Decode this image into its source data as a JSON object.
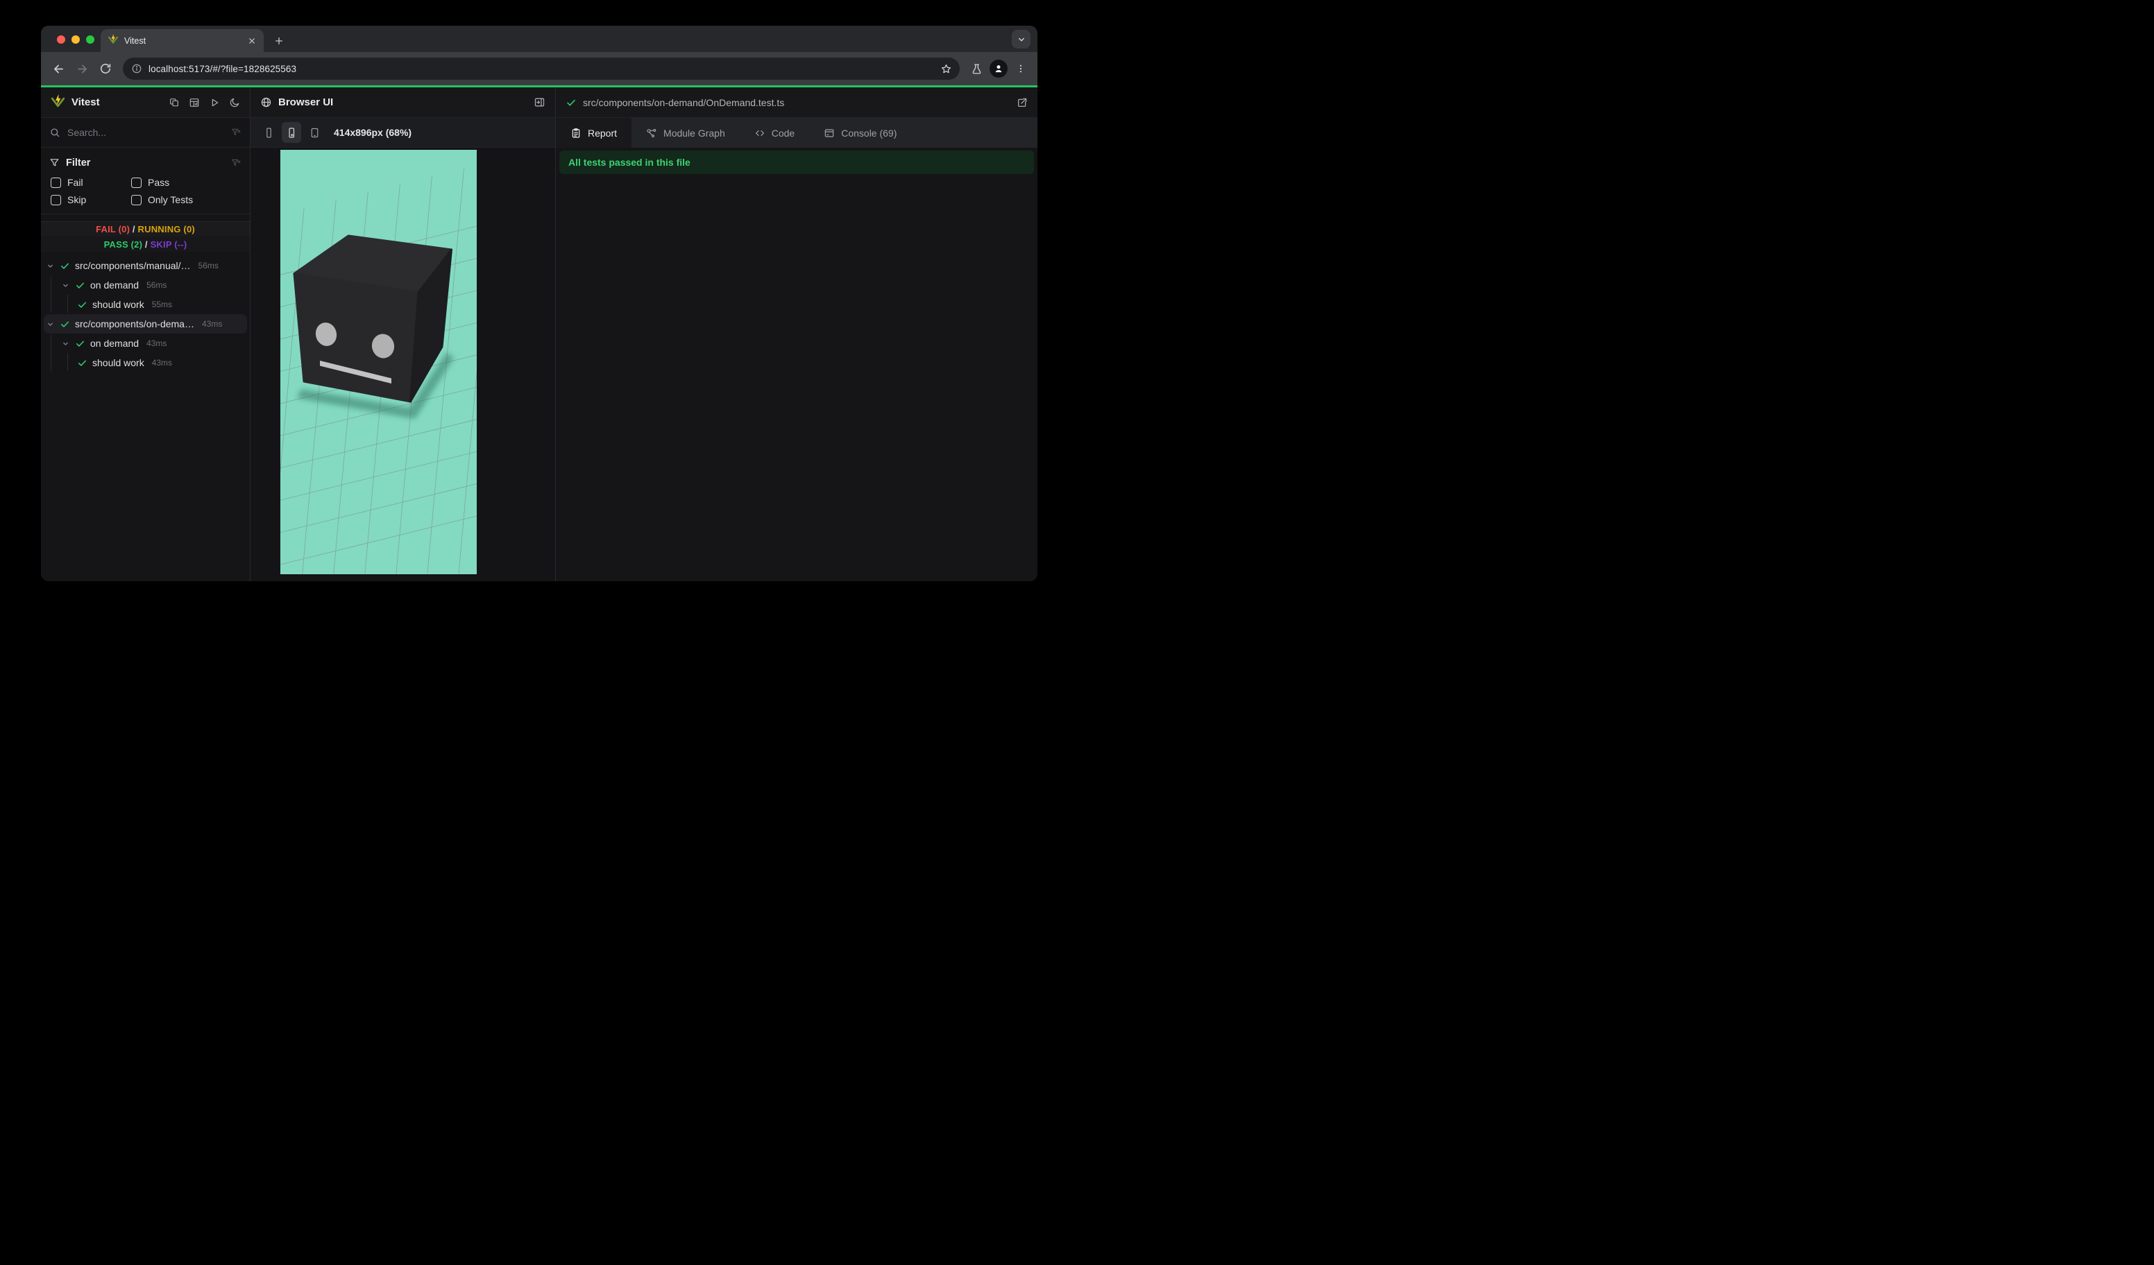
{
  "browser": {
    "tab_title": "Vitest",
    "url": "localhost:5173/#/?file=1828625563"
  },
  "sidebar": {
    "app_title": "Vitest",
    "search_placeholder": "Search...",
    "filter": {
      "title": "Filter",
      "options": [
        "Fail",
        "Pass",
        "Skip",
        "Only Tests"
      ]
    },
    "summary": {
      "fail": "FAIL (0)",
      "running": "RUNNING (0)",
      "pass": "PASS (2)",
      "skip": "SKIP (--)",
      "sep": " / "
    },
    "tree": [
      {
        "label": "src/components/manual/…",
        "time": "56ms"
      },
      {
        "label": "on demand",
        "time": "56ms"
      },
      {
        "label": "should work",
        "time": "55ms"
      },
      {
        "label": "src/components/on-dema…",
        "time": "43ms"
      },
      {
        "label": "on demand",
        "time": "43ms"
      },
      {
        "label": "should work",
        "time": "43ms"
      }
    ]
  },
  "browser_panel": {
    "title": "Browser UI",
    "viewport_label": "414x896px (68%)"
  },
  "report_panel": {
    "file_path": "src/components/on-demand/OnDemand.test.ts",
    "tabs": [
      {
        "label": "Report"
      },
      {
        "label": "Module Graph"
      },
      {
        "label": "Code"
      },
      {
        "label": "Console (69)"
      }
    ],
    "banner": "All tests passed in this file"
  },
  "colors": {
    "accent_green": "#23c55f",
    "viewport_mint": "#83dac1",
    "fail": "#f14c49",
    "running": "#d9a40a",
    "pass": "#2fc96b",
    "skip": "#7e3bd0",
    "banner_bg": "#13291b",
    "banner_text": "#3fd173"
  }
}
